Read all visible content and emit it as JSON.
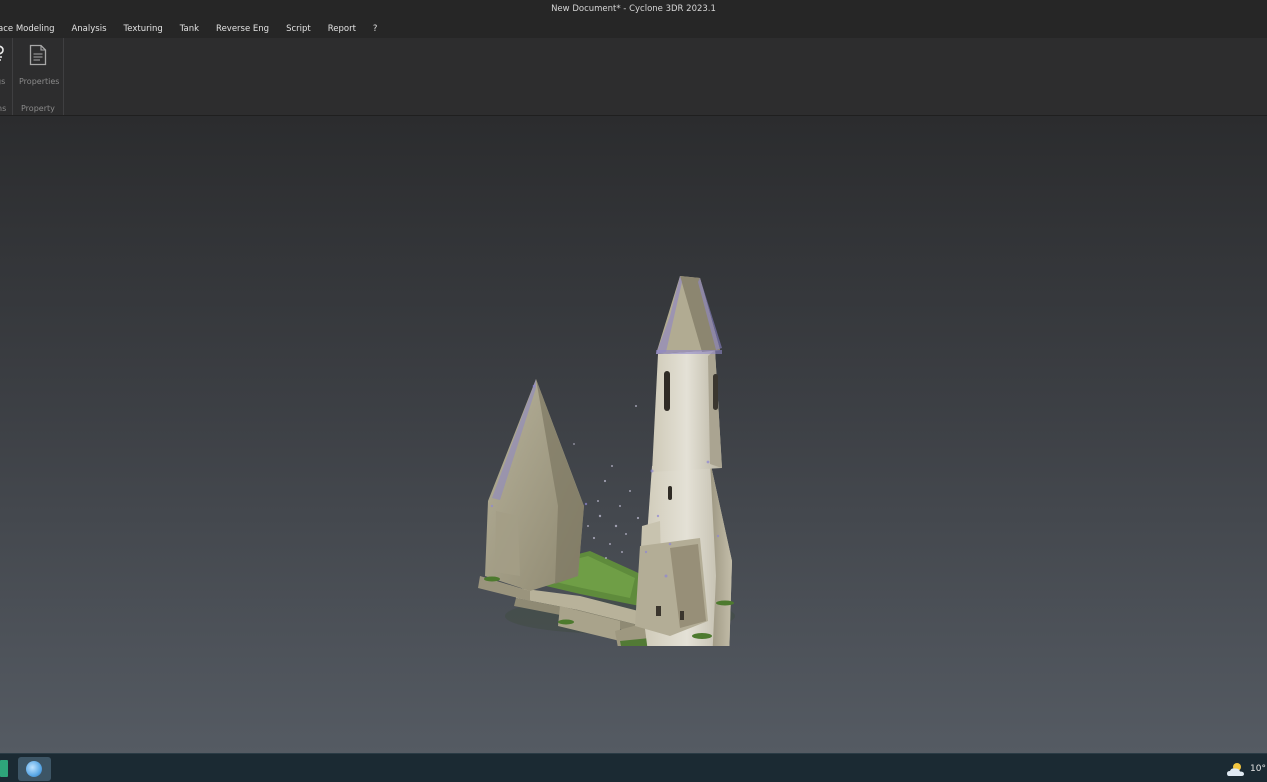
{
  "window": {
    "title": "New Document* - Cyclone 3DR 2023.1"
  },
  "menu": {
    "items": [
      "ace Modeling",
      "Analysis",
      "Texturing",
      "Tank",
      "Reverse Eng",
      "Script",
      "Report",
      "?"
    ]
  },
  "ribbon": {
    "partial_group": {
      "button_label": "gs",
      "group_label": "ns",
      "icon": "settings-icon"
    },
    "property_group": {
      "button_label": "Properties",
      "group_label": "Property",
      "icon": "document-icon"
    }
  },
  "viewport": {
    "model": "point-cloud-church-ruin"
  },
  "taskbar": {
    "pinned_apps": [
      "spreadsheet-app-icon",
      "cyclone-3dr-app-icon"
    ],
    "weather": {
      "icon": "partly-cloudy-icon",
      "temperature": "10°"
    }
  },
  "colors": {
    "background": "#252627",
    "ribbon": "#2d2d2e",
    "taskbar": "#1b2a33",
    "viewport_top": "#2b2c2e",
    "viewport_bottom": "#555b63"
  }
}
